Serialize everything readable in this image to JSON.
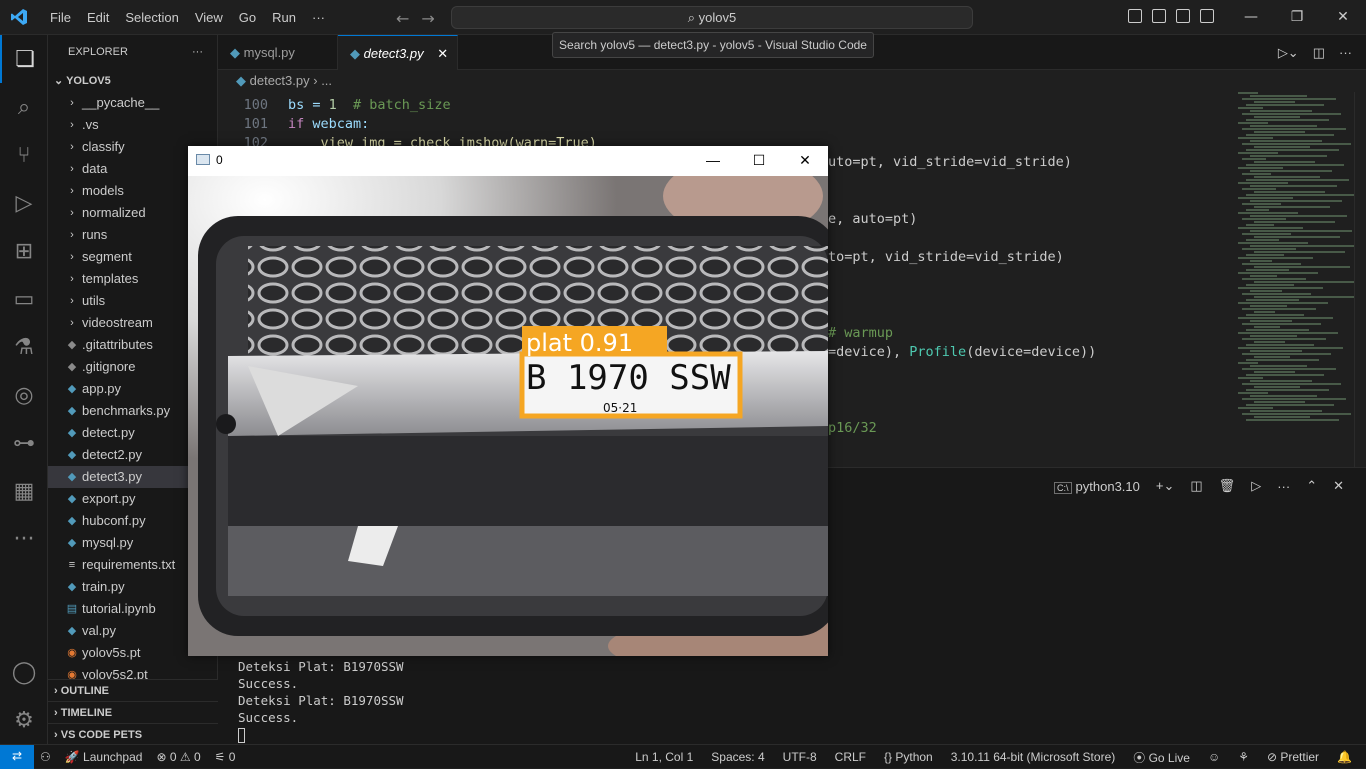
{
  "titlebar": {
    "menu": [
      "File",
      "Edit",
      "Selection",
      "View",
      "Go",
      "Run",
      "···"
    ],
    "search": "yolov5",
    "tooltip": "Search yolov5 — detect3.py - yolov5 - Visual Studio Code"
  },
  "explorer": {
    "title": "EXPLORER",
    "more": "···",
    "root": "YOLOV5",
    "items": [
      {
        "label": "__pycache__",
        "kind": "folder"
      },
      {
        "label": ".vs",
        "kind": "folder"
      },
      {
        "label": "classify",
        "kind": "folder"
      },
      {
        "label": "data",
        "kind": "folder"
      },
      {
        "label": "models",
        "kind": "folder"
      },
      {
        "label": "normalized",
        "kind": "folder"
      },
      {
        "label": "runs",
        "kind": "folder"
      },
      {
        "label": "segment",
        "kind": "folder"
      },
      {
        "label": "templates",
        "kind": "folder"
      },
      {
        "label": "utils",
        "kind": "folder"
      },
      {
        "label": "videostream",
        "kind": "folder"
      },
      {
        "label": ".gitattributes",
        "kind": "file"
      },
      {
        "label": ".gitignore",
        "kind": "file"
      },
      {
        "label": "app.py",
        "kind": "py"
      },
      {
        "label": "benchmarks.py",
        "kind": "py"
      },
      {
        "label": "detect.py",
        "kind": "py"
      },
      {
        "label": "detect2.py",
        "kind": "py"
      },
      {
        "label": "detect3.py",
        "kind": "py",
        "selected": true
      },
      {
        "label": "export.py",
        "kind": "py"
      },
      {
        "label": "hubconf.py",
        "kind": "py"
      },
      {
        "label": "mysql.py",
        "kind": "py"
      },
      {
        "label": "requirements.txt",
        "kind": "txt"
      },
      {
        "label": "train.py",
        "kind": "py"
      },
      {
        "label": "tutorial.ipynb",
        "kind": "nb"
      },
      {
        "label": "val.py",
        "kind": "py"
      },
      {
        "label": "yolov5s.pt",
        "kind": "rss"
      },
      {
        "label": "yolov5s2.pt",
        "kind": "rss"
      }
    ],
    "sections": [
      "OUTLINE",
      "TIMELINE",
      "VS CODE PETS"
    ]
  },
  "tabs": [
    {
      "label": "mysql.py",
      "active": false
    },
    {
      "label": "detect3.py",
      "active": true
    }
  ],
  "breadcrumb": {
    "file": "detect3.py",
    "more": "..."
  },
  "editor": {
    "line_numbers": [
      "100",
      "101",
      "102"
    ],
    "fragments": {
      "l100a": "bs = ",
      "l100b": "1",
      "l100c": "  # batch_size",
      "l101a": "if",
      "l101b": " webcam:",
      "l102": "    view_img = check_imshow(warn=True)",
      "r1": "uto=pt, vid_stride=vid_stride)",
      "r2": "e, auto=pt)",
      "r3": "to=pt, vid_stride=vid_stride)",
      "r4": "# warmup",
      "r5a": "=device), ",
      "r5b": "Profile",
      "r5c": "(device=device))",
      "r6": "p16/32"
    }
  },
  "panel": {
    "shell": "python3.10",
    "lines": [
      "Deteksi Plat: B1970SSW",
      "Success.",
      "Deteksi Plat: B1970SSW",
      "Success."
    ]
  },
  "cv_window": {
    "title": "0",
    "detection_label": "plat 0.91",
    "plate_text": "B 1970 SSW",
    "plate_sub": "05·21"
  },
  "status": {
    "launchpad": "Launchpad",
    "errors": "0",
    "warnings": "0",
    "ports": "0",
    "position": "Ln 1, Col 1",
    "spaces": "Spaces: 4",
    "encoding": "UTF-8",
    "eol": "CRLF",
    "language": "Python",
    "interpreter": "3.10.11 64-bit (Microsoft Store)",
    "golive": "Go Live",
    "prettier": "Prettier"
  },
  "colors": {
    "accent": "#0078d4",
    "detection_box": "#f5a623"
  }
}
